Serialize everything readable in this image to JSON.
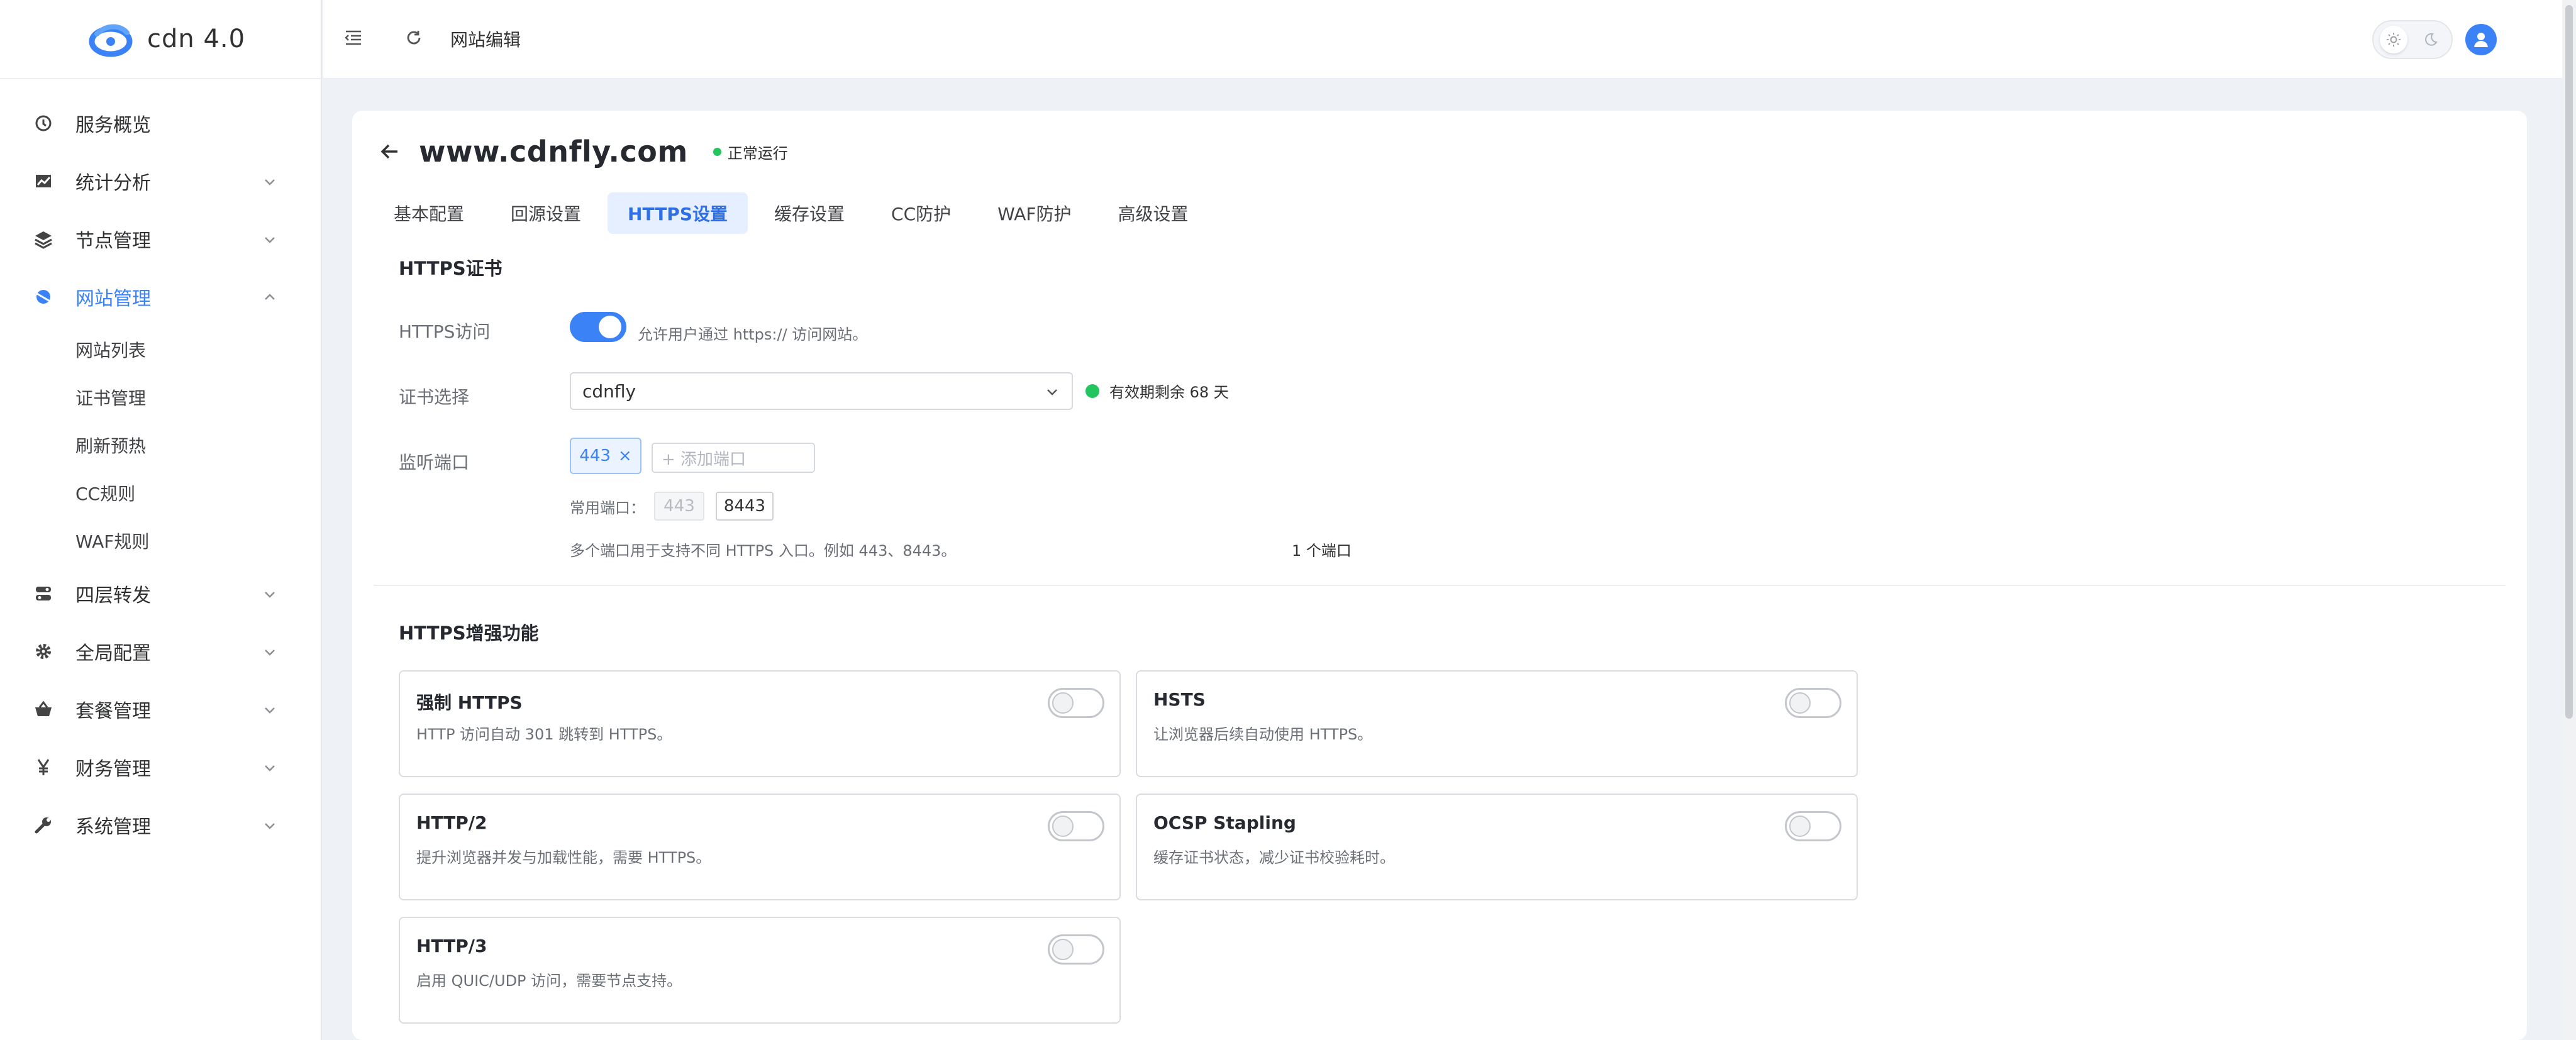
{
  "app": {
    "name": "cdn 4.0"
  },
  "sidebar": {
    "items": [
      {
        "label": "服务概览",
        "icon": "dashboard-icon"
      },
      {
        "label": "统计分析",
        "icon": "chart-icon"
      },
      {
        "label": "节点管理",
        "icon": "layers-icon"
      },
      {
        "label": "网站管理",
        "icon": "globe-icon"
      },
      {
        "label": "四层转发",
        "icon": "forward-icon"
      },
      {
        "label": "全局配置",
        "icon": "gear-icon"
      },
      {
        "label": "套餐管理",
        "icon": "basket-icon"
      },
      {
        "label": "财务管理",
        "icon": "yen-icon"
      },
      {
        "label": "系统管理",
        "icon": "wrench-icon"
      }
    ],
    "sub_items": [
      "网站列表",
      "证书管理",
      "刷新预热",
      "CC规则",
      "WAF规则"
    ]
  },
  "header": {
    "breadcrumb": "网站编辑"
  },
  "site": {
    "domain": "www.cdnfly.com",
    "status": "正常运行"
  },
  "tabs": [
    "基本配置",
    "回源设置",
    "HTTPS设置",
    "缓存设置",
    "CC防护",
    "WAF防护",
    "高级设置"
  ],
  "cert_section": {
    "title": "HTTPS证书",
    "https_access_label": "HTTPS访问",
    "https_access_hint": "允许用户通过 https:// 访问网站。",
    "https_access_on": true,
    "cert_label": "证书选择",
    "cert_value": "cdnfly",
    "cert_validity": "有效期剩余 68 天",
    "port_label": "监听端口",
    "port_chip": "443",
    "port_chip_remove": "×",
    "port_placeholder": "+ 添加端口",
    "common_ports_label": "常用端口：",
    "common_ports": [
      "443",
      "8443"
    ],
    "port_hint": "多个端口用于支持不同 HTTPS 入口。例如 443、8443。",
    "port_count": "1 个端口"
  },
  "enhance_section": {
    "title": "HTTPS增强功能",
    "features": [
      {
        "title": "强制 HTTPS",
        "desc": "HTTP 访问自动 301 跳转到 HTTPS。",
        "enabled": false
      },
      {
        "title": "HSTS",
        "desc": "让浏览器后续自动使用 HTTPS。",
        "enabled": false
      },
      {
        "title": "HTTP/2",
        "desc": "提升浏览器并发与加载性能，需要 HTTPS。",
        "enabled": false
      },
      {
        "title": "OCSP Stapling",
        "desc": "缓存证书状态，减少证书校验耗时。",
        "enabled": false
      },
      {
        "title": "HTTP/3",
        "desc": "启用 QUIC/UDP 访问，需要节点支持。",
        "enabled": false
      }
    ]
  },
  "colors": {
    "accent": "#3b82f6",
    "success": "#22c55e",
    "tab_active_bg": "#e5efff"
  }
}
